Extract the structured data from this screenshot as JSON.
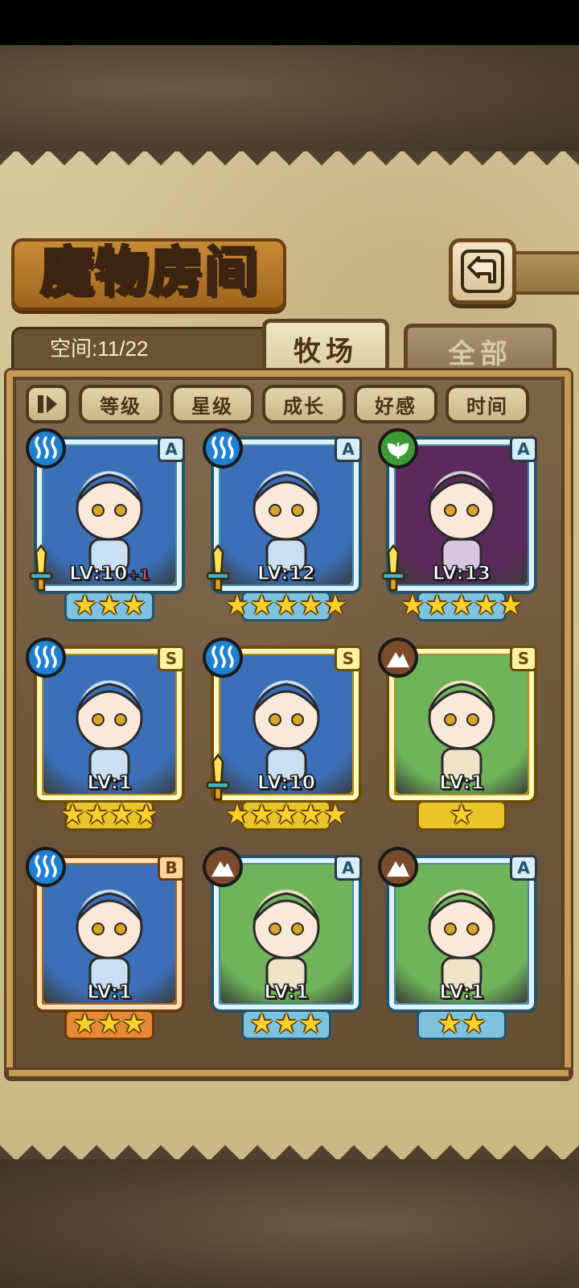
{
  "header": {
    "title": "魔物房间",
    "space_label": "空间:11/22",
    "back_icon": "back-arrow-icon"
  },
  "tabs": [
    {
      "label": "牧场",
      "active": true
    },
    {
      "label": "全部",
      "active": false
    }
  ],
  "sort": {
    "toggle_icon": "sort-toggle-icon",
    "buttons": [
      "等级",
      "星级",
      "成长",
      "好感",
      "时间"
    ]
  },
  "colors": {
    "rank_a": "#7dc3dd",
    "rank_s": "#e9c52a",
    "rank_b": "#e58a33",
    "water": "#1f7fd1",
    "nature": "#3e9a35",
    "earth": "#7a4a2c"
  },
  "monsters": [
    {
      "rank": "A",
      "element": "water",
      "level": "LV:10",
      "bonus": "+1",
      "stars": "★★★",
      "equipped": true
    },
    {
      "rank": "A",
      "element": "water",
      "level": "LV:12",
      "bonus": "",
      "stars": "★★★★★",
      "equipped": true
    },
    {
      "rank": "A",
      "element": "nature",
      "level": "LV:13",
      "bonus": "",
      "stars": "★★★★★",
      "equipped": true
    },
    {
      "rank": "S",
      "element": "water",
      "level": "LV:1",
      "bonus": "",
      "stars": "★★★★",
      "equipped": false
    },
    {
      "rank": "S",
      "element": "water",
      "level": "LV:10",
      "bonus": "",
      "stars": "★★★★★",
      "equipped": true
    },
    {
      "rank": "S",
      "element": "earth",
      "level": "LV:1",
      "bonus": "",
      "stars": "★",
      "equipped": false
    },
    {
      "rank": "B",
      "element": "water",
      "level": "LV:1",
      "bonus": "",
      "stars": "★★★",
      "equipped": false
    },
    {
      "rank": "A",
      "element": "earth",
      "level": "LV:1",
      "bonus": "",
      "stars": "★★★",
      "equipped": false
    },
    {
      "rank": "A",
      "element": "earth",
      "level": "LV:1",
      "bonus": "",
      "stars": "★★",
      "equipped": false
    }
  ]
}
